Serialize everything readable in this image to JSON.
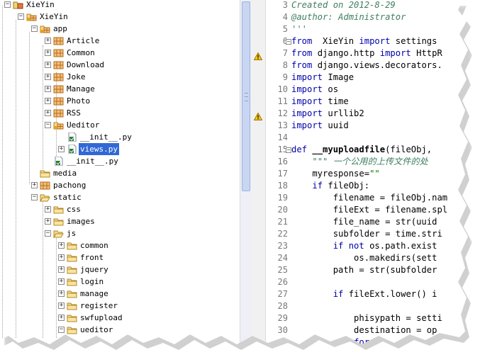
{
  "tree": {
    "items": [
      {
        "label": "XieYin",
        "icon": "project-icon",
        "expander": "minus",
        "depth": 0
      },
      {
        "label": "XieYin",
        "icon": "package-folder-icon",
        "expander": "minus",
        "depth": 1
      },
      {
        "label": "app",
        "icon": "package-folder-icon",
        "expander": "minus",
        "depth": 2
      },
      {
        "label": "Article",
        "icon": "package-icon",
        "expander": "plus",
        "depth": 3
      },
      {
        "label": "Common",
        "icon": "package-icon",
        "expander": "plus",
        "depth": 3
      },
      {
        "label": "Download",
        "icon": "package-icon",
        "expander": "plus",
        "depth": 3
      },
      {
        "label": "Joke",
        "icon": "package-icon",
        "expander": "plus",
        "depth": 3
      },
      {
        "label": "Manage",
        "icon": "package-icon",
        "expander": "plus",
        "depth": 3
      },
      {
        "label": "Photo",
        "icon": "package-icon",
        "expander": "plus",
        "depth": 3
      },
      {
        "label": "RSS",
        "icon": "package-icon",
        "expander": "plus",
        "depth": 3
      },
      {
        "label": "Ueditor",
        "icon": "package-folder-icon",
        "expander": "minus",
        "depth": 3
      },
      {
        "label": "__init__.py",
        "icon": "python-file-icon",
        "expander": "none",
        "depth": 4
      },
      {
        "label": "views.py",
        "icon": "python-file-icon",
        "expander": "plus",
        "depth": 4,
        "selected": true
      },
      {
        "label": "__init__.py",
        "icon": "python-file-icon",
        "expander": "none",
        "depth": 3
      },
      {
        "label": "media",
        "icon": "folder-icon",
        "expander": "none",
        "depth": 2
      },
      {
        "label": "pachong",
        "icon": "package-icon",
        "expander": "plus",
        "depth": 2
      },
      {
        "label": "static",
        "icon": "folder-open-icon",
        "expander": "minus",
        "depth": 2
      },
      {
        "label": "css",
        "icon": "folder-icon",
        "expander": "plus",
        "depth": 3
      },
      {
        "label": "images",
        "icon": "folder-icon",
        "expander": "plus",
        "depth": 3
      },
      {
        "label": "js",
        "icon": "folder-open-icon",
        "expander": "minus",
        "depth": 3
      },
      {
        "label": "common",
        "icon": "folder-icon",
        "expander": "plus",
        "depth": 4
      },
      {
        "label": "front",
        "icon": "folder-icon",
        "expander": "plus",
        "depth": 4
      },
      {
        "label": "jquery",
        "icon": "folder-icon",
        "expander": "plus",
        "depth": 4
      },
      {
        "label": "login",
        "icon": "folder-icon",
        "expander": "plus",
        "depth": 4
      },
      {
        "label": "manage",
        "icon": "folder-icon",
        "expander": "plus",
        "depth": 4
      },
      {
        "label": "register",
        "icon": "folder-icon",
        "expander": "plus",
        "depth": 4
      },
      {
        "label": "swfupload",
        "icon": "folder-icon",
        "expander": "plus",
        "depth": 4
      },
      {
        "label": "ueditor",
        "icon": "folder-icon",
        "expander": "minus",
        "depth": 4
      }
    ]
  },
  "editor": {
    "lines": [
      {
        "num": "3",
        "text": "Created on 2012-8-29",
        "style": "comment"
      },
      {
        "num": "4",
        "text": "@author: Administrator",
        "style": "comment"
      },
      {
        "num": "5",
        "text": "'''",
        "style": "comment"
      },
      {
        "num": "6",
        "fold": "minus",
        "parts": [
          [
            "kw",
            "from"
          ],
          [
            "",
            "  XieYin "
          ],
          [
            "kw",
            "import"
          ],
          [
            "",
            " settings"
          ]
        ]
      },
      {
        "num": "7",
        "warn": true,
        "parts": [
          [
            "kw",
            "from"
          ],
          [
            "",
            " django.http "
          ],
          [
            "kw",
            "import"
          ],
          [
            "",
            " HttpR"
          ]
        ]
      },
      {
        "num": "8",
        "parts": [
          [
            "kw",
            "from"
          ],
          [
            "",
            " django.views.decorators."
          ]
        ]
      },
      {
        "num": "9",
        "parts": [
          [
            "kw",
            "import"
          ],
          [
            "",
            " Image"
          ]
        ]
      },
      {
        "num": "10",
        "parts": [
          [
            "kw",
            "import"
          ],
          [
            "",
            " os"
          ]
        ]
      },
      {
        "num": "11",
        "parts": [
          [
            "kw",
            "import"
          ],
          [
            "",
            " time"
          ]
        ]
      },
      {
        "num": "12",
        "warn": true,
        "parts": [
          [
            "kw",
            "import"
          ],
          [
            "",
            " urllib2"
          ]
        ]
      },
      {
        "num": "13",
        "parts": [
          [
            "kw",
            "import"
          ],
          [
            "",
            " uuid"
          ]
        ]
      },
      {
        "num": "14",
        "parts": []
      },
      {
        "num": "15",
        "fold": "minus",
        "parts": [
          [
            "kw",
            "def"
          ],
          [
            "",
            " "
          ],
          [
            "fn",
            "__myuploadfile"
          ],
          [
            "",
            "(fileObj,"
          ]
        ]
      },
      {
        "num": "16",
        "parts": [
          [
            "",
            "    "
          ],
          [
            "ds",
            "\"\"\" 一个公用的上传文件的处"
          ]
        ]
      },
      {
        "num": "17",
        "parts": [
          [
            "",
            "    myresponse="
          ],
          [
            "st",
            "\"\""
          ]
        ]
      },
      {
        "num": "18",
        "parts": [
          [
            "",
            "    "
          ],
          [
            "kw",
            "if"
          ],
          [
            "",
            " fileObj:"
          ]
        ]
      },
      {
        "num": "19",
        "parts": [
          [
            "",
            "        filename = fileObj.nam"
          ]
        ]
      },
      {
        "num": "20",
        "parts": [
          [
            "",
            "        fileExt = filename.spl"
          ]
        ]
      },
      {
        "num": "21",
        "parts": [
          [
            "",
            "        file_name = str(uuid"
          ]
        ]
      },
      {
        "num": "22",
        "parts": [
          [
            "",
            "        subfolder = time.stri"
          ]
        ]
      },
      {
        "num": "23",
        "parts": [
          [
            "",
            "        "
          ],
          [
            "kw",
            "if not"
          ],
          [
            "",
            " os.path.exist"
          ]
        ]
      },
      {
        "num": "24",
        "parts": [
          [
            "",
            "            os.makedirs(sett"
          ]
        ]
      },
      {
        "num": "25",
        "parts": [
          [
            "",
            "        path = str(subfolder"
          ]
        ]
      },
      {
        "num": "26",
        "parts": []
      },
      {
        "num": "27",
        "parts": [
          [
            "",
            "        "
          ],
          [
            "kw",
            "if"
          ],
          [
            "",
            " fileExt.lower() i"
          ]
        ]
      },
      {
        "num": "28",
        "parts": []
      },
      {
        "num": "29",
        "parts": [
          [
            "",
            "            phisypath = setti"
          ]
        ]
      },
      {
        "num": "30",
        "parts": [
          [
            "",
            "            destination = op"
          ]
        ]
      },
      {
        "num": "",
        "parts": [
          [
            "",
            "            "
          ],
          [
            "kw",
            "for"
          ],
          [
            "",
            " c"
          ]
        ]
      }
    ]
  },
  "colors": {
    "selection": "#3168d5",
    "keyword": "#0000aa",
    "comment": "#3f7f5f",
    "string": "#008000",
    "line_number": "#787878"
  }
}
